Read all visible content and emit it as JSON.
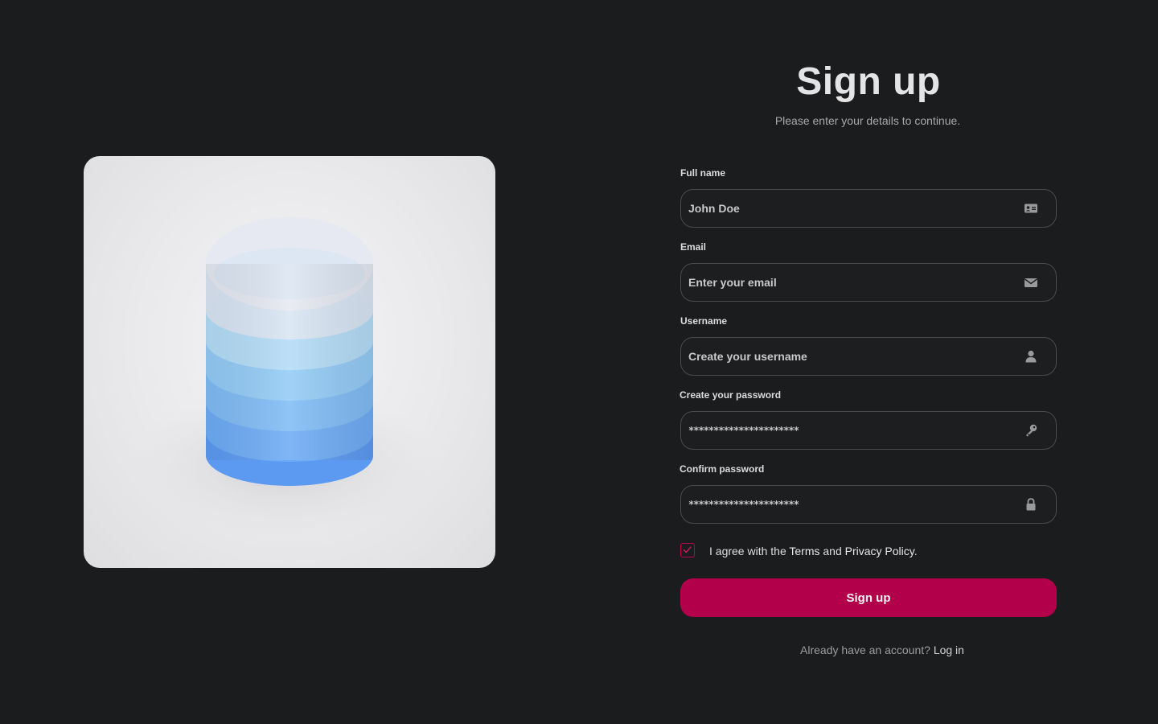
{
  "header": {
    "title": "Sign up",
    "subtitle": "Please enter your details to continue."
  },
  "form": {
    "full_name": {
      "label": "Full name",
      "value": "John Doe",
      "icon": "id-card-icon"
    },
    "email": {
      "label": "Email",
      "value": "Enter your email",
      "icon": "envelope-icon"
    },
    "username": {
      "label": "Username",
      "value": "Create your username",
      "icon": "user-icon"
    },
    "password": {
      "label": "Create your password",
      "value": "**********************",
      "icon": "key-icon"
    },
    "confirm_password": {
      "label": "Confirm password",
      "value": "**********************",
      "icon": "lock-icon"
    },
    "agree": {
      "checked": true,
      "prefix": "I agree with the ",
      "terms": "Terms",
      "and": " and ",
      "privacy": "Privacy Policy",
      "suffix": "."
    },
    "submit_label": "Sign up"
  },
  "footer": {
    "prompt": "Already have an account? ",
    "login_label": "Log in"
  },
  "colors": {
    "background": "#1b1c1e",
    "accent": "#b3004a",
    "field_border": "#4a4b4e"
  }
}
